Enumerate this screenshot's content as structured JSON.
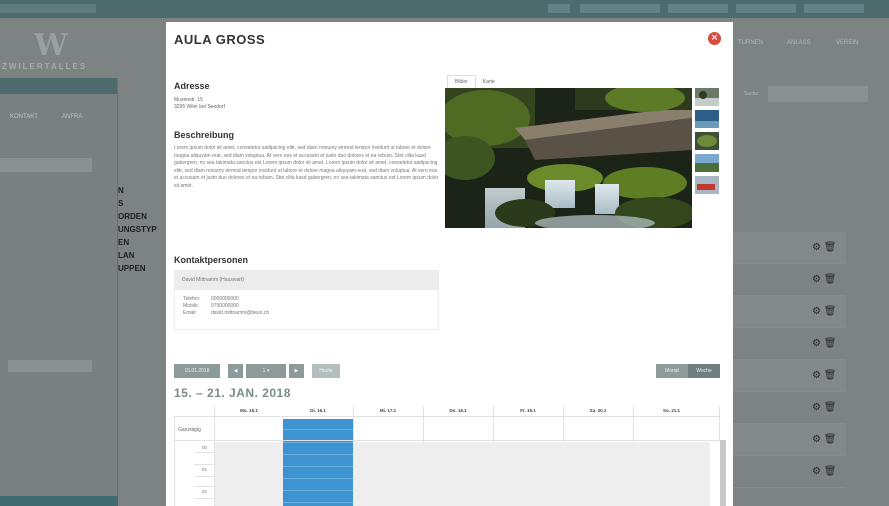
{
  "background": {
    "logo": {
      "mark": "W",
      "text": "ZWILERTALLES"
    },
    "right_nav": [
      "TURNEN",
      "ANLASS",
      "VEREIN"
    ],
    "search_label": "Suche:",
    "left_panel_tabs": [
      "KONTAKT",
      "ANFRA"
    ],
    "left_menu": [
      "N",
      "S",
      "ORDEN",
      "UNGSTYP",
      "EN",
      "LAN",
      "UPPEN"
    ],
    "row_icons": [
      "⚙ 🗑"
    ]
  },
  "modal": {
    "title": "AULA GROSS",
    "close_icon": "×",
    "address": {
      "heading": "Adresse",
      "lines": [
        "Musterstr. 15",
        "3295 Wiler bei Seedorf"
      ]
    },
    "description": {
      "heading": "Beschreibung",
      "text": "Lorem ipsum dolor sit amet, consetetur sadipscing elitr, sed diam nonumy eirmod tempor invidunt ut labore et dolore magna aliquyam erat, sed diam voluptua. At vero eos et accusam et justo duo dolores et ea rebum. Stet clita kasd gubergren, no sea takimata sanctus est Lorem ipsum dolor sit amet. Lorem ipsum dolor sit amet, consetetur sadipscing elitr, sed diam nonumy eirmod tempor invidunt ut labore et dolore magna aliquyam erat, sed diam voluptua. At vero eos et accusam et justo duo dolores et ea rebum. Stet clita kasd gubergren, no sea takimata sanctus est Lorem ipsum dolor sit amet."
    },
    "contacts": {
      "heading": "Kontaktpersonen",
      "name": "David Mittnamm (Hauswart)",
      "rows": [
        {
          "key": "Telefon:",
          "value": "0000000000"
        },
        {
          "key": "Mobile:",
          "value": "0790000000"
        },
        {
          "key": "Email:",
          "value": "david.mittnamm@beun.ch"
        }
      ]
    },
    "image_tabs": [
      "Bilder",
      "Karte"
    ],
    "calendar": {
      "toolbar": {
        "date_button": "15.01.2018",
        "prev": "◀",
        "mid": "1 ▾",
        "next": "▶",
        "today": "Heute",
        "month": "Monat",
        "week": "Woche"
      },
      "title": "15. – 21. JAN. 2018",
      "days": [
        "Mo. 15.1",
        "Di. 16.1",
        "Mi. 17.1",
        "Do. 18.1",
        "Fr. 19.1",
        "Sa. 20.1",
        "So. 21.1"
      ],
      "allday_label": "Ganztägig",
      "hours": [
        "00",
        "01",
        "02"
      ]
    }
  }
}
